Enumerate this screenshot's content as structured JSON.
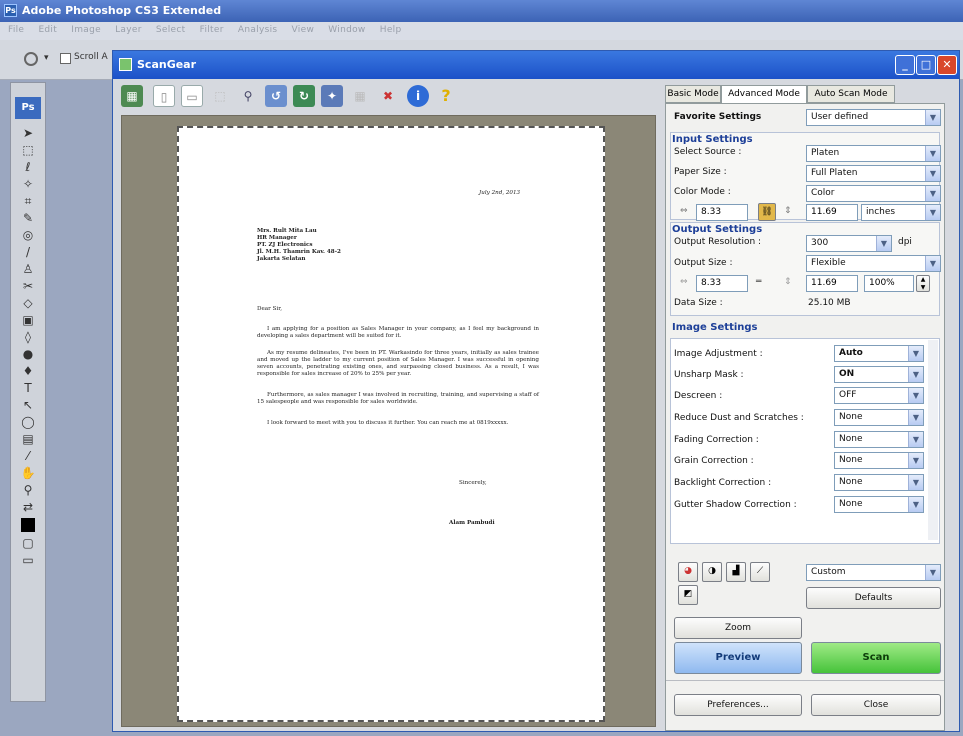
{
  "photoshop": {
    "title": "Adobe Photoshop CS3 Extended",
    "menu": [
      "File",
      "Edit",
      "Image",
      "Layer",
      "Select",
      "Filter",
      "Analysis",
      "View",
      "Window",
      "Help"
    ],
    "options_label": "Scroll A"
  },
  "scangear": {
    "title": "ScanGear",
    "tabs": [
      "Basic Mode",
      "Advanced Mode",
      "Auto Scan Mode"
    ],
    "favorite": {
      "label": "Favorite Settings",
      "value": "User defined"
    },
    "input": {
      "header": "Input Settings",
      "select_source": {
        "label": "Select Source :",
        "value": "Platen"
      },
      "paper_size": {
        "label": "Paper Size :",
        "value": "Full Platen"
      },
      "color_mode": {
        "label": "Color Mode :",
        "value": "Color"
      },
      "width": "8.33",
      "height": "11.69",
      "unit": "inches"
    },
    "output": {
      "header": "Output Settings",
      "resolution": {
        "label": "Output Resolution :",
        "value": "300",
        "unit": "dpi"
      },
      "size": {
        "label": "Output Size :",
        "value": "Flexible"
      },
      "width": "8.33",
      "height": "11.69",
      "scale": "100%",
      "data_size": {
        "label": "Data Size :",
        "value": "25.10 MB"
      }
    },
    "image": {
      "header": "Image Settings",
      "rows": [
        {
          "label": "Image Adjustment :",
          "value": "Auto"
        },
        {
          "label": "Unsharp Mask :",
          "value": "ON"
        },
        {
          "label": "Descreen :",
          "value": "OFF"
        },
        {
          "label": "Reduce Dust and Scratches :",
          "value": "None"
        },
        {
          "label": "Fading Correction :",
          "value": "None"
        },
        {
          "label": "Grain Correction :",
          "value": "None"
        },
        {
          "label": "Backlight Correction :",
          "value": "None"
        },
        {
          "label": "Gutter Shadow Correction :",
          "value": "None"
        }
      ]
    },
    "tone_preset": "Custom",
    "defaults_label": "Defaults",
    "zoom_label": "Zoom",
    "preview_label": "Preview",
    "scan_label": "Scan",
    "preferences_label": "Preferences...",
    "close_label": "Close"
  },
  "letter": {
    "date": "July 2nd, 2013",
    "recipient": [
      "Mrs. Rult Mita Lau",
      "HR Manager",
      "PT. ZJ Electronics",
      "Jl. M.H. Thamrin Kav. 48-2",
      "Jakarta Selatan"
    ],
    "salutation": "Dear Sir,",
    "paragraphs": [
      "I am applying for a position as Sales Manager in your company, as I feel my background in developing a sales department will be suited for it.",
      "As my resume delineates, I've been in PT. Warkasindo for three years, initially as sales trainee and moved up the ladder to my current position of Sales Manager. I was successful in opening seven accounts, penetrating existing ones, and surpassing closed business. As a result, I was responsible for sales increase of 20% to 25% per year.",
      "Furthermore, as sales manager I was involved in recruiting, training, and supervising a staff of 15 salespeople and was responsible for sales worldwide.",
      "I look forward to meet with you to discuss it further. You can reach me at 0819xxxxx."
    ],
    "closing": "Sincerely,",
    "signature": "Alam Pambudi"
  }
}
